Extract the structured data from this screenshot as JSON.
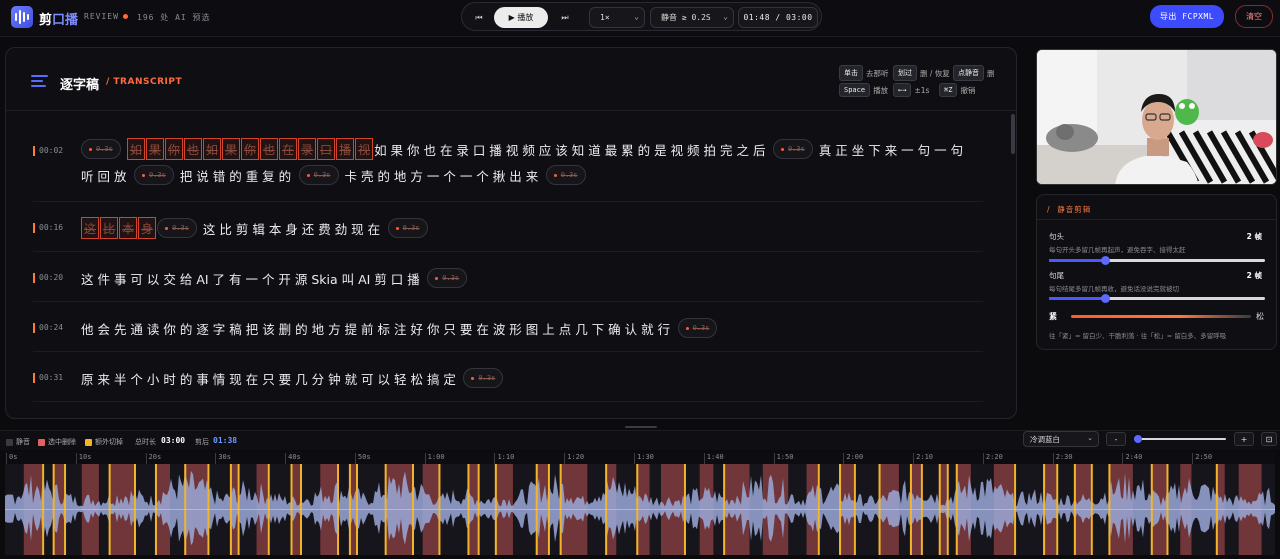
{
  "app": {
    "brand_part1": "剪",
    "brand_part2": "口播",
    "review": "REVIEW",
    "review_count": "196 处 AI 预选"
  },
  "transport": {
    "prev_icon": "⏮",
    "play_label": "▶ 播放",
    "next_icon": "⏭",
    "speed": "1×",
    "silence": "静音 ≥ 0.2S",
    "timecode": "01:48 / 03:00"
  },
  "actions": {
    "export": "导出 FCPXML",
    "clear": "清空"
  },
  "transcript": {
    "title": "逐字稿",
    "subtitle": "/ TRANSCRIPT",
    "shortcuts": [
      {
        "key": "单击",
        "desc": "去那听"
      },
      {
        "key": "划过",
        "desc": "删 / 恢复"
      },
      {
        "key": "点静音",
        "desc": "删"
      },
      {
        "key": "Space",
        "desc": "播放"
      },
      {
        "key": "←→",
        "desc": "±1s"
      },
      {
        "key": "⌘Z",
        "desc": "撤销"
      }
    ],
    "pill_text": "0.3s",
    "rows": [
      {
        "time": "00:02",
        "lines": [
          [
            {
              "t": "pill"
            },
            {
              "t": "cut",
              "v": "如"
            },
            {
              "t": "cut",
              "v": "果"
            },
            {
              "t": "cut",
              "v": "你"
            },
            {
              "t": "cut",
              "v": "也"
            },
            {
              "t": "cut",
              "v": "如"
            },
            {
              "t": "cut",
              "v": "果"
            },
            {
              "t": "cut",
              "v": "你"
            },
            {
              "t": "cut",
              "v": "也"
            },
            {
              "t": "cut",
              "v": "在"
            },
            {
              "t": "cut",
              "v": "录"
            },
            {
              "t": "cut",
              "v": "口"
            },
            {
              "t": "cut",
              "v": "播"
            },
            {
              "t": "cut",
              "v": "视"
            },
            {
              "t": "w",
              "v": "如 果 你 也 在 录 口 播 视 频 应 该 知 道 最 累 的 是 视 频 拍 完 之 后"
            },
            {
              "t": "pill"
            },
            {
              "t": "w",
              "v": "真 正 坐 下 来 一 句 一 句"
            }
          ],
          [
            {
              "t": "w",
              "v": "听 回 放"
            },
            {
              "t": "pill"
            },
            {
              "t": "w",
              "v": "把 说 错 的 重 复 的"
            },
            {
              "t": "pill"
            },
            {
              "t": "w",
              "v": "卡 壳 的 地 方 一 个 一 个 揪 出 来"
            },
            {
              "t": "pill"
            }
          ]
        ]
      },
      {
        "time": "00:16",
        "lines": [
          [
            {
              "t": "cut",
              "v": "这"
            },
            {
              "t": "cut",
              "v": "比"
            },
            {
              "t": "cut",
              "v": "本"
            },
            {
              "t": "cut",
              "v": "身"
            },
            {
              "t": "pill"
            },
            {
              "t": "w",
              "v": "这 比 剪 辑 本 身 还 费 劲 现 在"
            },
            {
              "t": "pill"
            }
          ]
        ]
      },
      {
        "time": "00:20",
        "lines": [
          [
            {
              "t": "w",
              "v": "这 件 事 可 以 交 给 AI 了 有 一 个 开 源 Skia 叫 AI 剪 口 播"
            },
            {
              "t": "pill"
            }
          ]
        ]
      },
      {
        "time": "00:24",
        "lines": [
          [
            {
              "t": "w",
              "v": "他 会 先 通 读 你 的 逐 字 稿 把 该 删 的 地 方 提 前 标 注 好 你 只 要 在 波 形 图 上 点 几 下 确 认 就 行"
            },
            {
              "t": "pill"
            }
          ]
        ]
      },
      {
        "time": "00:31",
        "lines": [
          [
            {
              "t": "w",
              "v": "原 来 半 个 小 时 的 事 情 现 在 只 要 几 分 钟 就 可 以 轻 松 搞 定"
            },
            {
              "t": "pill"
            }
          ]
        ]
      }
    ]
  },
  "trim": {
    "title": "静音剪辑",
    "head_label": "句头",
    "head_value": "2 帧",
    "head_hint": "每句开头多留几帧再起声，避免吞字、接得太赶",
    "head_level": 0.26,
    "tail_label": "句尾",
    "tail_value": "2 帧",
    "tail_hint": "每句结尾多留几帧再收，避免话没说完就被切",
    "tail_level": 0.26,
    "tight": "紧",
    "loose": "松",
    "footer": "往「紧」= 留白少、干脆利落 · 往「松」= 留白多、多留呼吸"
  },
  "timeline": {
    "legend_silence": "静音",
    "legend_selected": "选中删除",
    "legend_extra": "额外切掉",
    "total_label": "总时长",
    "total_value": "03:00",
    "after_label": "剪后",
    "after_value": "01:38",
    "theme": "冷调蓝白",
    "zoom_minus": "-",
    "zoom_plus": "+",
    "fit": "⊡",
    "ticks": [
      "0s",
      "10s",
      "20s",
      "30s",
      "40s",
      "50s",
      "1:00",
      "1:10",
      "1:20",
      "1:30",
      "1:40",
      "1:50",
      "2:00",
      "2:10",
      "2:20",
      "2:30",
      "2:40",
      "2:50"
    ],
    "colors": {
      "silence": "#3a3a42",
      "selected": "#e26060",
      "extra": "#f2b52a",
      "wave": "#9aa8d8"
    }
  }
}
